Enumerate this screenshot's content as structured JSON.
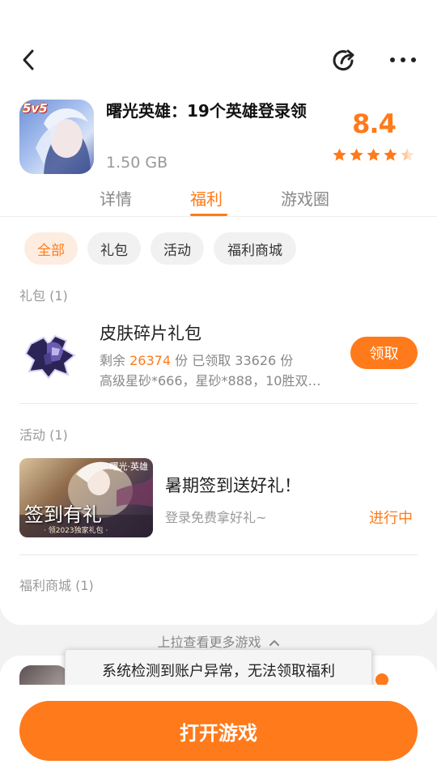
{
  "app": {
    "badge": "5v5",
    "title": "曙光英雄：19个英雄登录领",
    "size": "1.50 GB",
    "rating": "8.4",
    "stars": 4.5
  },
  "tabs": [
    {
      "label": "详情"
    },
    {
      "label": "福利"
    },
    {
      "label": "游戏圈"
    }
  ],
  "filters": [
    {
      "label": "全部"
    },
    {
      "label": "礼包"
    },
    {
      "label": "活动"
    },
    {
      "label": "福利商城"
    }
  ],
  "gift_section": {
    "label": "礼包 (1)",
    "item": {
      "title": "皮肤碎片礼包",
      "remaining_prefix": "剩余",
      "remaining": "26374",
      "claimed_text": "份 已领取 33626 份",
      "desc": "高级星砂*666，星砂*888，10胜双…",
      "claim_label": "领取"
    }
  },
  "event_section": {
    "label": "活动 (1)",
    "item": {
      "banner_tag": "曙光·英雄",
      "banner_text": "签到有礼",
      "banner_sub": "· 领2023独家礼包 ·",
      "title": "暑期签到送好礼！",
      "subtitle": "登录免费拿好礼~",
      "status": "进行中"
    }
  },
  "mall_section": {
    "label": "福利商城 (1)"
  },
  "pull_hint": "上拉查看更多游戏",
  "toast": "系统检测到账户异常，无法领取福利",
  "open_game": "打开游戏",
  "colors": {
    "accent": "#ff7a1a",
    "muted": "#999999"
  }
}
